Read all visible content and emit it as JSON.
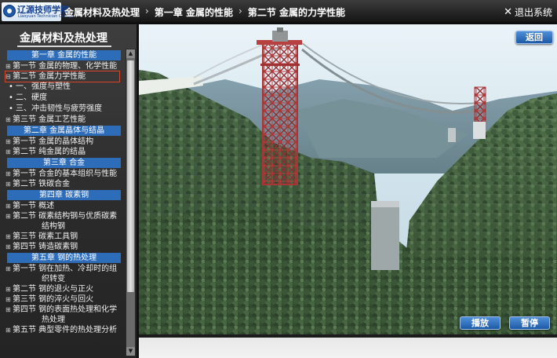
{
  "header": {
    "logo_cn": "辽源技师学院",
    "logo_en": "Liaoyuan Technician College",
    "breadcrumb": [
      "金属材料及热处理",
      "第一章 金属的性能",
      "第二节 金属的力学性能"
    ],
    "separator": "›",
    "exit_label": "退出系统"
  },
  "sidebar": {
    "title": "金属材料及热处理",
    "chapters": [
      {
        "label": "第一章 金属的性能",
        "sections": [
          {
            "label": "第一节 金属的物理、化学性能",
            "marker": "⊞"
          },
          {
            "label": "第二节 金属力学性能",
            "marker": "⊟",
            "selected": true,
            "subs": [
              "一、强度与塑性",
              "二、硬度",
              "三、冲击韧性与疲劳强度"
            ]
          },
          {
            "label": "第三节 金属工艺性能",
            "marker": "⊞"
          }
        ]
      },
      {
        "label": "第二章 金属晶体与结晶",
        "sections": [
          {
            "label": "第一节 金属的晶体结构",
            "marker": "⊞"
          },
          {
            "label": "第二节 纯金属的结晶",
            "marker": "⊞"
          }
        ]
      },
      {
        "label": "第三章 合金",
        "sections": [
          {
            "label": "第一节 合金的基本组织与性能",
            "marker": "⊞"
          },
          {
            "label": "第二节 铁碳合金",
            "marker": "⊞"
          }
        ]
      },
      {
        "label": "第四章 碳素钢",
        "sections": [
          {
            "label": "第一节 概述",
            "marker": "⊞"
          },
          {
            "label": "第二节 碳素结构钢与优质碳素",
            "cont": "结构钢",
            "marker": "⊞"
          },
          {
            "label": "第三节 碳素工具钢",
            "marker": "⊞"
          },
          {
            "label": "第四节 铸造碳素钢",
            "marker": "⊞"
          }
        ]
      },
      {
        "label": "第五章 钢的热处理",
        "sections": [
          {
            "label": "第一节 钢在加热、冷却时的组",
            "cont": "织转变",
            "marker": "⊞"
          },
          {
            "label": "第二节 钢的退火与正火",
            "marker": "⊞"
          },
          {
            "label": "第三节 钢的淬火与回火",
            "marker": "⊞"
          },
          {
            "label": "第四节 钢的表面热处理和化学",
            "cont": "热处理",
            "marker": "⊞"
          },
          {
            "label": "第五节 典型零件的热处理分析",
            "marker": "⊞"
          }
        ]
      }
    ]
  },
  "viewer": {
    "back_label": "返回",
    "play_label": "播放",
    "pause_label": "暂停",
    "colors": {
      "sky": "#cfe4ef",
      "tower": "#c23a3a",
      "forest": "#2e4a2c"
    }
  }
}
